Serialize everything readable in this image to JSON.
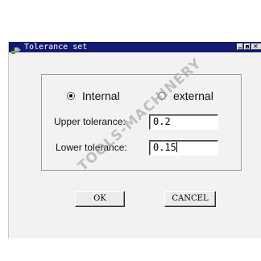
{
  "window": {
    "title": "Tolerance set"
  },
  "titlebar_controls": [
    "minimize",
    "maximize",
    "close"
  ],
  "radio_options": [
    {
      "label": "Internal",
      "selected": true
    },
    {
      "label": "external",
      "selected": false
    }
  ],
  "fields": {
    "upper": {
      "label": "Upper tolerance:",
      "value": "0.2"
    },
    "lower": {
      "label": "Lower tolerance:",
      "value": "0.15"
    }
  },
  "buttons": {
    "ok": "OK",
    "cancel": "CANCEL"
  },
  "watermark": "TOOLS-MACHINERY",
  "colors": {
    "titlebar": "#141a72",
    "dialog": "#f2f2f2"
  }
}
